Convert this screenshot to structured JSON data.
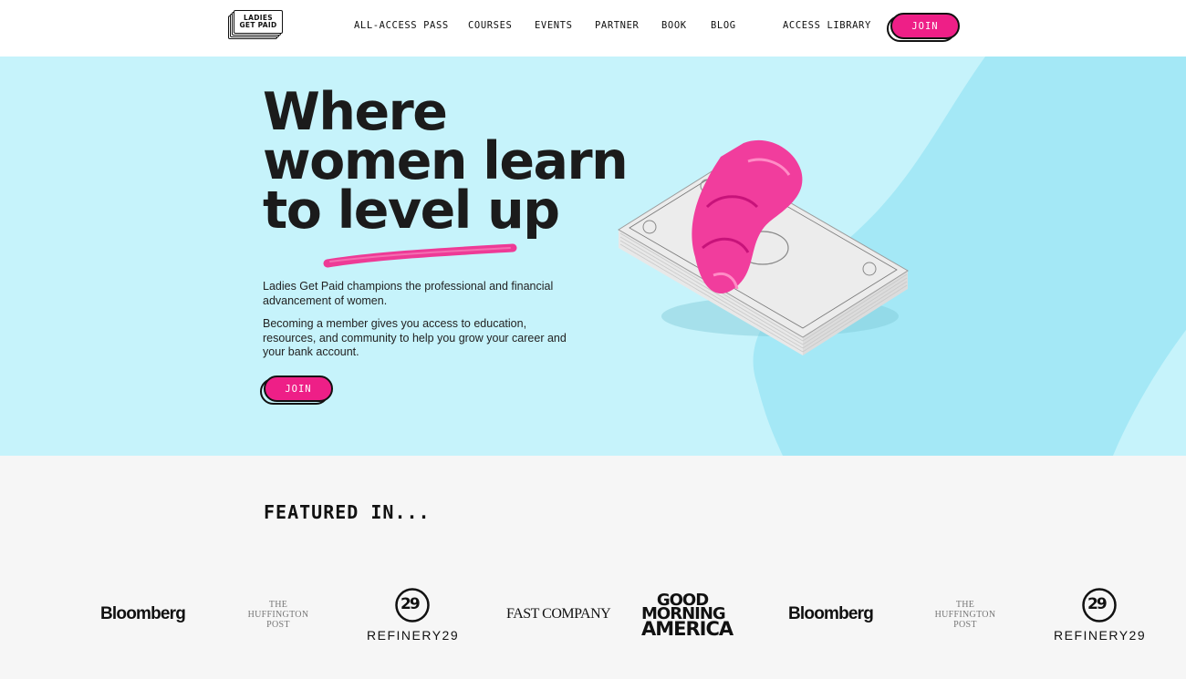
{
  "header": {
    "logo": {
      "line1": "LADIES",
      "line2": "GET PAID"
    },
    "nav": [
      "ALL-ACCESS PASS",
      "COURSES",
      "EVENTS",
      "PARTNER",
      "BOOK",
      "BLOG"
    ],
    "access_library": "ACCESS LIBRARY",
    "join_label": "JOIN"
  },
  "hero": {
    "headline": [
      "Where",
      "women learn",
      "to level up"
    ],
    "paragraph1": "Ladies Get Paid champions the professional and financial advancement of women.",
    "paragraph2": "Becoming a member gives you access to education, resources, and community to help you grow your career and your bank account.",
    "join_label": "JOIN",
    "image": "stack-of-dollar-bills-with-pink-scrunchie"
  },
  "featured": {
    "title": "FEATURED IN...",
    "logos": [
      {
        "type": "bloomberg",
        "text": "Bloomberg"
      },
      {
        "type": "huffpost",
        "lines": [
          "THE",
          "HUFFINGTON",
          "POST"
        ]
      },
      {
        "type": "refinery29",
        "text": "REFINERY29",
        "badge": "29"
      },
      {
        "type": "fastcompany",
        "text": "FAST COMPANY"
      },
      {
        "type": "gma",
        "lines": [
          "GOOD",
          "MORNING",
          "AMERICA"
        ]
      },
      {
        "type": "bloomberg",
        "text": "Bloomberg"
      },
      {
        "type": "huffpost",
        "lines": [
          "THE",
          "HUFFINGTON",
          "POST"
        ]
      },
      {
        "type": "refinery29",
        "text": "REFINERY29",
        "badge": "29"
      }
    ]
  },
  "colors": {
    "accent_pink": "#ee1f87",
    "hero_bg": "#c6f3fb",
    "hero_shape": "#9fe6f5",
    "featured_bg": "#f6f6f6"
  }
}
